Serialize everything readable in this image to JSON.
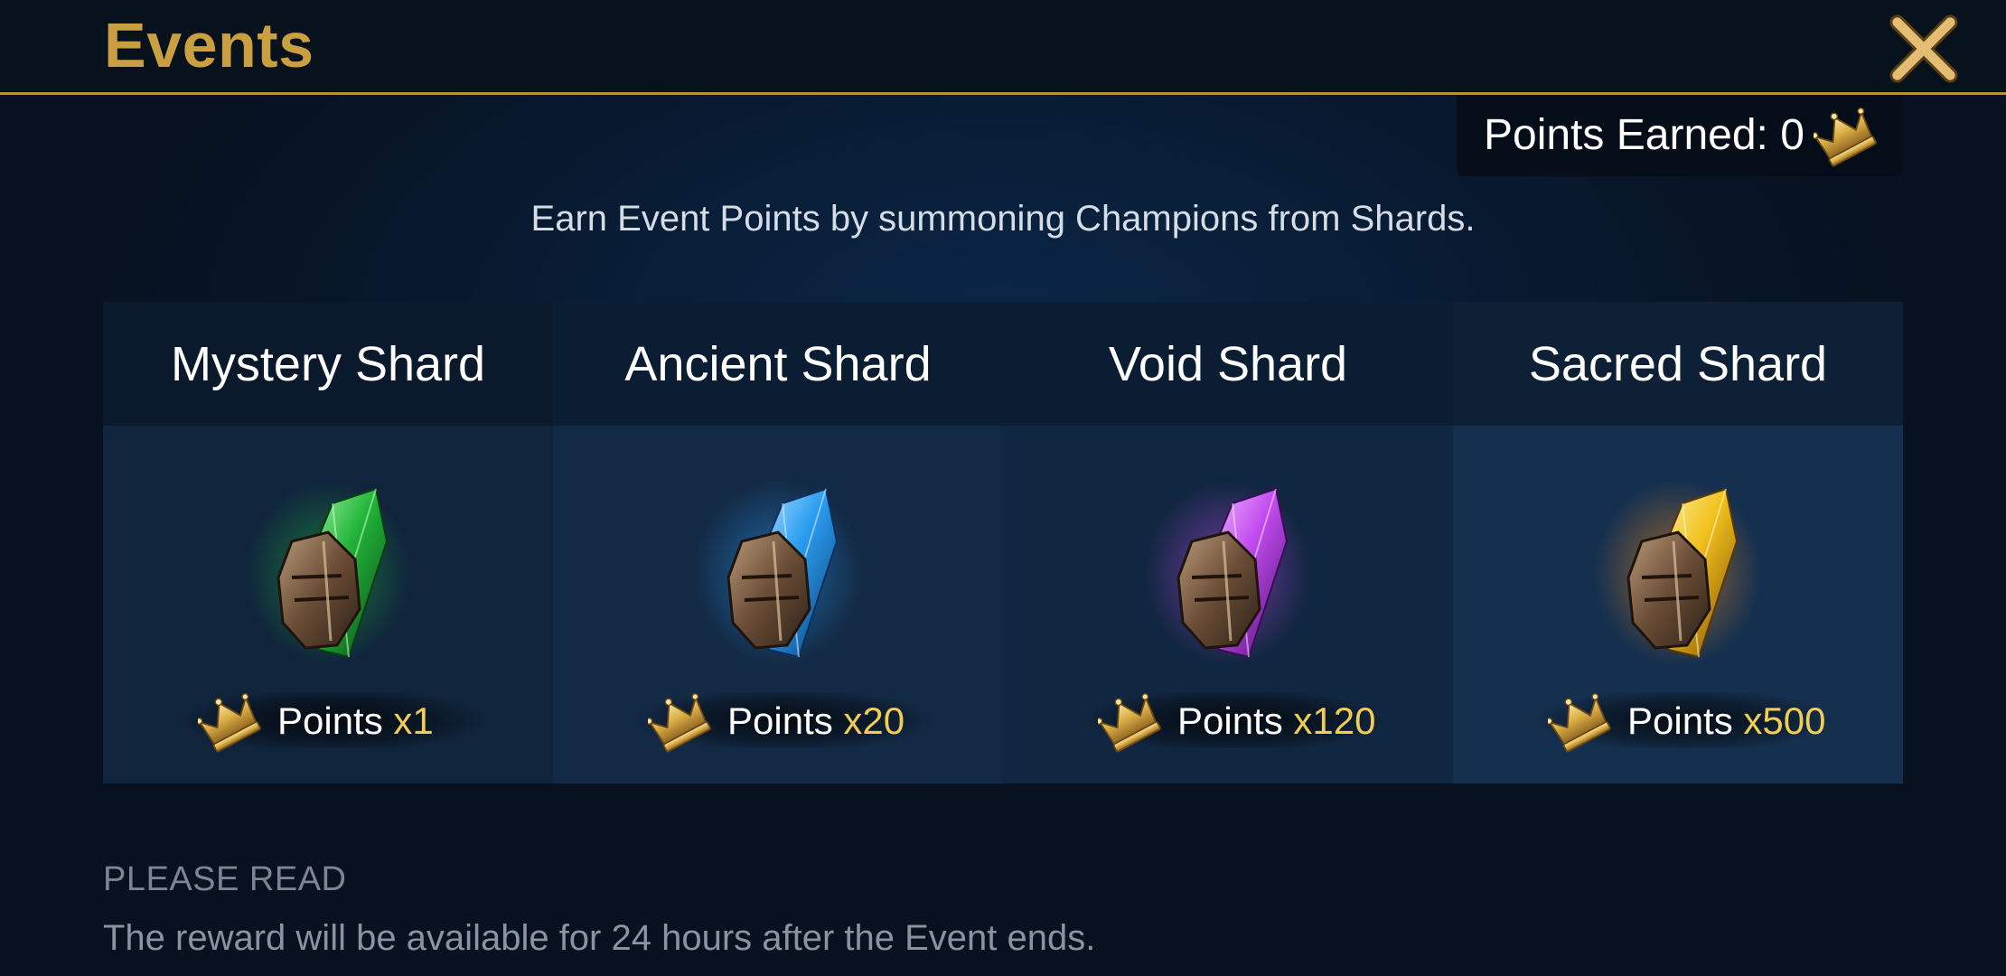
{
  "header": {
    "title": "Events",
    "close_icon": "close-x-icon"
  },
  "points_earned": {
    "label": "Points Earned: 0",
    "icon": "crown-icon"
  },
  "intro_text": "Earn Event Points by summoning Champions from Shards.",
  "shards": [
    {
      "name": "Mystery Shard",
      "points_label": "Points",
      "multiplier": "x1",
      "color": "#22b53a"
    },
    {
      "name": "Ancient Shard",
      "points_label": "Points",
      "multiplier": "x20",
      "color": "#2a9df0"
    },
    {
      "name": "Void Shard",
      "points_label": "Points",
      "multiplier": "x120",
      "color": "#c34cf0"
    },
    {
      "name": "Sacred Shard",
      "points_label": "Points",
      "multiplier": "x500",
      "color": "#f2c21c"
    }
  ],
  "notice": {
    "heading": "PLEASE READ",
    "text": "The reward will be available for 24 hours after the Event ends."
  },
  "colors": {
    "accent_gold": "#c99f42",
    "multiplier_yellow": "#f1cd55"
  }
}
